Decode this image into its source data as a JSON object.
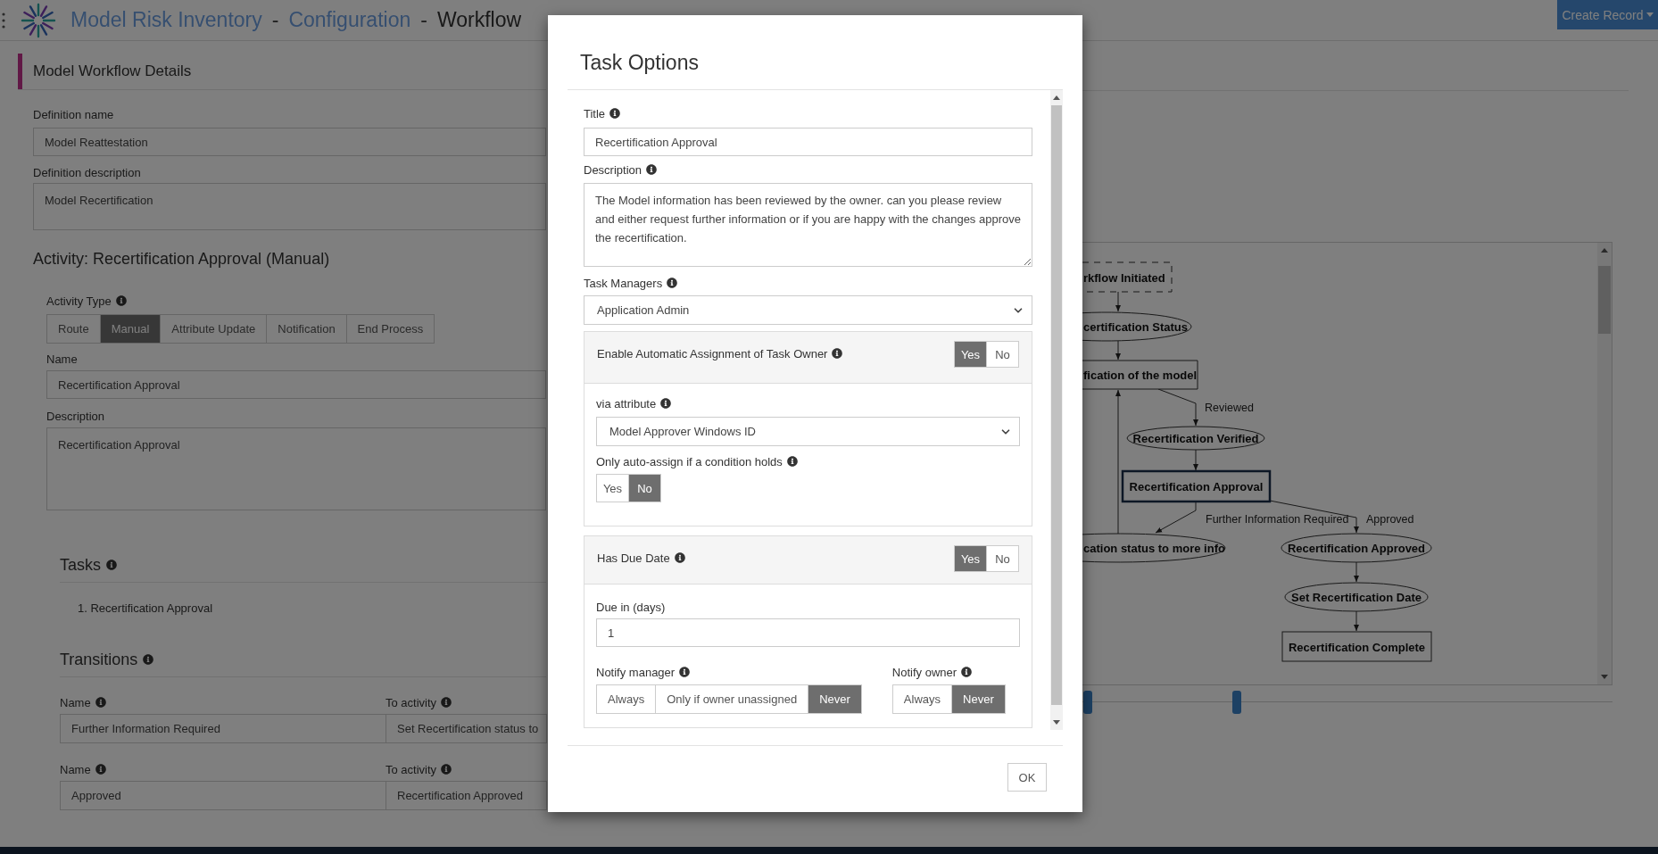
{
  "header": {
    "breadcrumb": [
      {
        "text": "Model Risk Inventory",
        "kind": "link"
      },
      {
        "text": "-",
        "kind": "separator"
      },
      {
        "text": "Configuration",
        "kind": "link"
      },
      {
        "text": "-",
        "kind": "separator"
      },
      {
        "text": "Workflow",
        "kind": "current"
      }
    ],
    "create_button": "Create Record"
  },
  "details": {
    "heading": "Model Workflow Details",
    "definition_name": {
      "label": "Definition name",
      "value": "Model Reattestation"
    },
    "definition_description": {
      "label": "Definition description",
      "value": "Model Recertification"
    }
  },
  "activity": {
    "heading": "Activity: Recertification Approval (Manual)",
    "type_label": "Activity Type",
    "types": [
      {
        "label": "Route",
        "selected": false
      },
      {
        "label": "Manual",
        "selected": true
      },
      {
        "label": "Attribute Update",
        "selected": false
      },
      {
        "label": "Notification",
        "selected": false
      },
      {
        "label": "End Process",
        "selected": false
      }
    ],
    "name": {
      "label": "Name",
      "value": "Recertification Approval"
    },
    "description": {
      "label": "Description",
      "value": "Recertification Approval"
    }
  },
  "tasks": {
    "heading": "Tasks",
    "items": [
      "1. Recertification Approval"
    ]
  },
  "transitions": {
    "heading": "Transitions",
    "rows": [
      {
        "name_label": "Name",
        "to_label": "To activity",
        "name": "Further Information Required",
        "to": "Set Recertification status to"
      },
      {
        "name_label": "Name",
        "to_label": "To activity",
        "name": "Approved",
        "to": "Recertification Approved"
      }
    ]
  },
  "diagram": {
    "nodes": [
      {
        "label": "rkflow Initiated",
        "kind": "dashed-box",
        "selected": false
      },
      {
        "label": "certification Status",
        "kind": "ellipse",
        "selected": false
      },
      {
        "label": "fication of the model",
        "kind": "box",
        "selected": false
      },
      {
        "label": "Recertification Verified",
        "kind": "ellipse",
        "selected": false
      },
      {
        "label": "Recertification Approval",
        "kind": "box",
        "selected": true
      },
      {
        "label": "cation status to more info",
        "kind": "ellipse",
        "selected": false
      },
      {
        "label": "Recertification Approved",
        "kind": "ellipse",
        "selected": false
      },
      {
        "label": "Set Recertification Date",
        "kind": "ellipse",
        "selected": false
      },
      {
        "label": "Recertification Complete",
        "kind": "box",
        "selected": false
      }
    ],
    "edge_labels": [
      "Reviewed",
      "Further Information Required",
      "Approved"
    ]
  },
  "modal": {
    "title": "Task Options",
    "title_field": {
      "label": "Title",
      "value": "Recertification Approval"
    },
    "description": {
      "label": "Description",
      "value": "The Model information has been reviewed by the owner. can you please review and either request further information or if you are happy with the changes approve the recertification."
    },
    "task_managers": {
      "label": "Task Managers",
      "value": "Application Admin"
    },
    "auto_assign": {
      "label": "Enable Automatic Assignment of Task Owner",
      "options": [
        {
          "label": "Yes",
          "selected": true
        },
        {
          "label": "No",
          "selected": false
        }
      ],
      "via_attribute": {
        "label": "via attribute",
        "value": "Model Approver Windows ID"
      },
      "condition": {
        "label": "Only auto-assign if a condition holds",
        "options": [
          {
            "label": "Yes",
            "selected": false
          },
          {
            "label": "No",
            "selected": true
          }
        ]
      }
    },
    "due_date": {
      "label": "Has Due Date",
      "options": [
        {
          "label": "Yes",
          "selected": true
        },
        {
          "label": "No",
          "selected": false
        }
      ],
      "due_in": {
        "label": "Due in (days)",
        "value": "1"
      },
      "notify_manager": {
        "label": "Notify manager",
        "options": [
          {
            "label": "Always",
            "selected": false
          },
          {
            "label": "Only if owner unassigned",
            "selected": false
          },
          {
            "label": "Never",
            "selected": true
          }
        ]
      },
      "notify_owner": {
        "label": "Notify owner",
        "options": [
          {
            "label": "Always",
            "selected": false
          },
          {
            "label": "Never",
            "selected": true
          }
        ]
      }
    },
    "ok": "OK"
  }
}
